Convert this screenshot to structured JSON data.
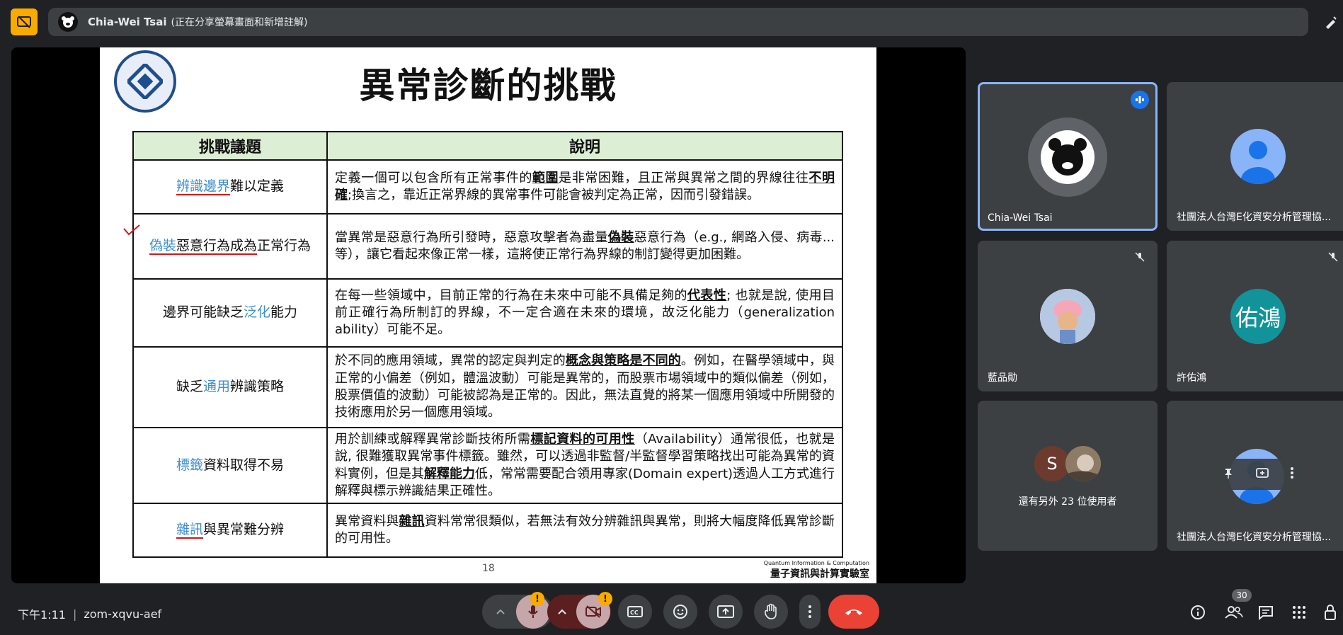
{
  "header": {
    "presenter_name": "Chia-Wei Tsai",
    "presenter_status": "(正在分享螢幕畫面和新增註解)"
  },
  "slide": {
    "title": "異常診斷的挑戰",
    "col_topic": "挑戰議題",
    "col_desc": "說明",
    "rows": [
      {
        "topic_hl": "辨識邊界",
        "topic_rest": "難以定義",
        "d1": "定義一個可以包含所有正常事件的",
        "d1b": "範圍",
        "d2": "是非常困難，且正常與異常之間的界線往往",
        "d2b": "不明確",
        "d3": ";換言之，靠近正常界線的異常事件可能會被判定為正常，因而引發錯誤。"
      },
      {
        "topic_hl": "偽裝",
        "topic_mid": "惡意行為成為",
        "topic_end": "正常行為",
        "d1": "當異常是惡意行為所引發時，惡意攻擊者為盡量",
        "d1b": "偽裝",
        "d2": "惡意行為（e.g., 網路入侵、病毒...等），讓它看起來像正常一樣，這將使正常行為界線的制訂變得更加困難。"
      },
      {
        "topic_pre": "邊界可能缺乏",
        "topic_hl": "泛化",
        "topic_rest": "能力",
        "d1": "在每一些領域中，目前正常的行為在未來中可能不具備足夠的",
        "d1b": "代表性",
        "d2": "; 也就是說, 使用目前正確行為所制訂的界線，不一定合適在未來的環境，故泛化能力（generalization ability）可能不足。"
      },
      {
        "topic_pre": "缺乏",
        "topic_hl": "通用",
        "topic_rest": "辨識策略",
        "d1": "於不同的應用領域，異常的認定與判定的",
        "d1b": "概念與策略是不同的",
        "d2": "。例如，在醫學領域中，與正常的小偏差（例如，體溫波動）可能是異常的，而股票市場領域中的類似偏差（例如，股票價值的波動）可能被認為是正常的。因此，無法直覺的將某一個應用領域中所開發的技術應用於另一個應用領域。"
      },
      {
        "topic_hl": "標籤",
        "topic_rest": "資料取得不易",
        "d1": "用於訓練或解釋異常診斷技術所需",
        "d1b": "標記資料的可用性",
        "d2": "（Availability）通常很低，也就是說, 很難獲取異常事件標籤。雖然，可以透過非監督/半監督學習策略找出可能為異常的資料實例，但是其",
        "d2b": "解釋能力",
        "d3": "低，常常需要配合領用專家(Domain expert)透過人工方式進行解釋與標示辨識結果正確性。"
      },
      {
        "topic_hl": "雜訊",
        "topic_rest": "與異常難分辨",
        "d1": "異常資料與",
        "d1b": "雜訊",
        "d2": "資料常常很類似，若無法有效分辨雜訊與異常，則將大幅度降低異常診斷的可用性。"
      }
    ],
    "page_number": "18",
    "lab_en": "Quantum Information & Computation",
    "lab_zh": "量子資訊與計算實驗室"
  },
  "participants": [
    {
      "name": "Chia-Wei Tsai"
    },
    {
      "name": "社團法人台灣E化資安分析管理協..."
    },
    {
      "name": "藍品勛"
    },
    {
      "name": "許佑鴻",
      "initials": "佑鴻"
    },
    {
      "name": "還有另外 23 位使用者",
      "initial": "S"
    },
    {
      "name": "社團法人台灣E化資安分析管理協..."
    }
  ],
  "footer": {
    "time": "下午1:11",
    "meeting_code": "zom-xqvu-aef",
    "people_count": "30",
    "warn_symbol": "!"
  },
  "colors": {
    "accent_blue": "#1a73e8",
    "hangup_red": "#ea4335",
    "warning_yellow": "#f9ab00"
  }
}
